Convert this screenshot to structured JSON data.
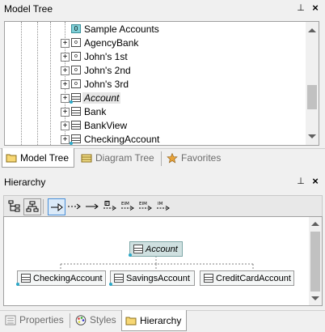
{
  "model_tree_panel": {
    "title": "Model Tree",
    "pin": "⊥",
    "close": "×",
    "items": [
      {
        "label": "Sample Accounts",
        "icon": "package-icon",
        "expandable": false,
        "italic": false
      },
      {
        "label": "AgencyBank",
        "icon": "object-icon",
        "expandable": true,
        "italic": false
      },
      {
        "label": "John's 1st",
        "icon": "object-icon",
        "expandable": true,
        "italic": false
      },
      {
        "label": "John's 2nd",
        "icon": "object-icon",
        "expandable": true,
        "italic": false
      },
      {
        "label": "John's 3rd",
        "icon": "object-icon",
        "expandable": true,
        "italic": false
      },
      {
        "label": "Account",
        "icon": "class-icon",
        "expandable": true,
        "italic": true
      },
      {
        "label": "Bank",
        "icon": "class-icon",
        "expandable": true,
        "italic": false
      },
      {
        "label": "BankView",
        "icon": "class-icon",
        "expandable": true,
        "italic": false
      },
      {
        "label": "CheckingAccount",
        "icon": "class-icon",
        "expandable": true,
        "italic": false
      }
    ],
    "tabs": [
      {
        "label": "Model Tree",
        "icon": "folder-icon",
        "active": true
      },
      {
        "label": "Diagram Tree",
        "icon": "diagram-icon",
        "active": false
      },
      {
        "label": "Favorites",
        "icon": "star-icon",
        "active": false
      }
    ]
  },
  "hierarchy_panel": {
    "title": "Hierarchy",
    "pin": "⊥",
    "close": "×",
    "toolbar": [
      {
        "name": "tree-view-icon",
        "selected": false
      },
      {
        "name": "graph-view-icon",
        "selected": false
      },
      {
        "name": "generalization-icon",
        "selected": true
      },
      {
        "name": "dependency-icon",
        "selected": false
      },
      {
        "name": "association-icon",
        "selected": false
      },
      {
        "name": "realization-icon",
        "selected": false
      },
      {
        "name": "import-icon",
        "selected": false
      },
      {
        "name": "merge-icon",
        "selected": false
      },
      {
        "name": "access-icon",
        "selected": false
      }
    ],
    "focus_class": "Account",
    "children": [
      "CheckingAccount",
      "SavingsAccount",
      "CreditCardAccount"
    ],
    "tabs": [
      {
        "label": "Properties",
        "icon": "properties-icon",
        "active": false
      },
      {
        "label": "Styles",
        "icon": "palette-icon",
        "active": false
      },
      {
        "label": "Hierarchy",
        "icon": "hierarchy-icon",
        "active": true
      }
    ]
  },
  "colors": {
    "selection_focus": "#cfe0e0",
    "link_dot": "#2aa8c8",
    "toolbar_selected": "#dbeaf8"
  }
}
